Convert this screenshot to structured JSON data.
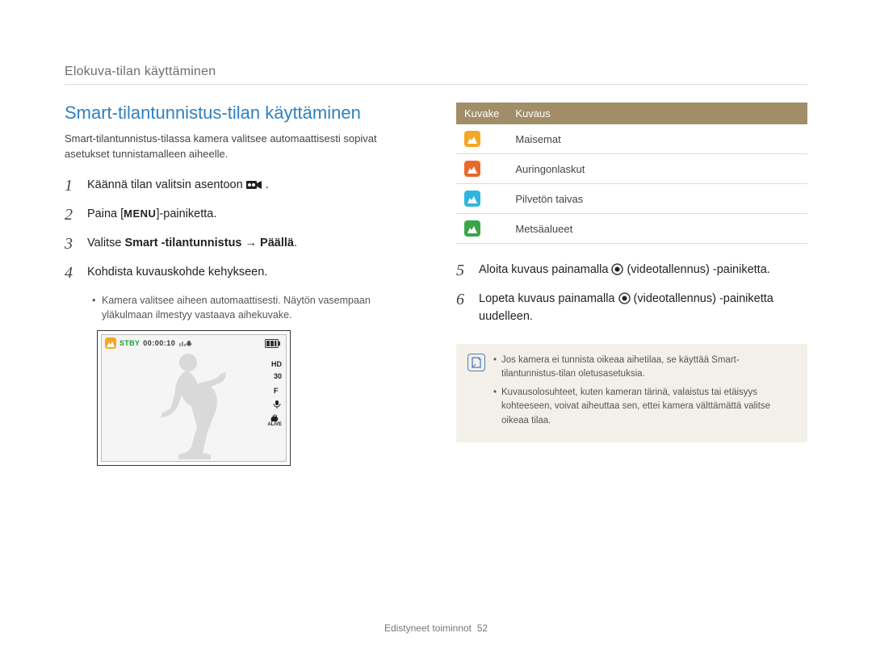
{
  "running_head": "Elokuva-tilan käyttäminen",
  "title": "Smart-tilantunnistus-tilan käyttäminen",
  "intro": "Smart-tilantunnistus-tilassa kamera valitsee automaattisesti sopivat asetukset tunnistamalleen aiheelle.",
  "steps_left": {
    "s1": {
      "num": "1",
      "pre": "Käännä tilan valitsin asentoon ",
      "post": "."
    },
    "s2": {
      "num": "2",
      "pre": "Paina [",
      "menu": "MENU",
      "post": "]-painiketta."
    },
    "s3": {
      "num": "3",
      "pre": "Valitse ",
      "bold": "Smart -tilantunnistus → Päällä",
      "post": "."
    },
    "s4": {
      "num": "4",
      "text": "Kohdista kuvauskohde kehykseen.",
      "sub": "Kamera valitsee aiheen automaattisesti. Näytön vasempaan yläkulmaan ilmestyy vastaava aihekuvake."
    }
  },
  "lcd": {
    "stby": "STBY",
    "time": "00:00:10",
    "hd": "HD",
    "fps": "30",
    "f": "F",
    "alive": "ALIVE"
  },
  "table": {
    "head_icon": "Kuvake",
    "head_desc": "Kuvaus",
    "rows": [
      {
        "color": "#f5a623",
        "label": "Maisemat"
      },
      {
        "color": "#e86a2b",
        "label": "Auringonlaskut"
      },
      {
        "color": "#2fb6e0",
        "label": "Pilvetön taivas"
      },
      {
        "color": "#3aa54a",
        "label": "Metsäalueet"
      }
    ]
  },
  "steps_right": {
    "s5": {
      "num": "5",
      "pre": "Aloita kuvaus painamalla ",
      "post": " (videotallennus) -painiketta."
    },
    "s6": {
      "num": "6",
      "pre": "Lopeta kuvaus painamalla ",
      "post": " (videotallennus) -painiketta uudelleen."
    }
  },
  "note": {
    "b1": "Jos kamera ei tunnista oikeaa aihetilaa, se käyttää Smart-tilantunnistus-tilan oletusasetuksia.",
    "b2": "Kuvausolosuhteet, kuten kameran tärinä, valaistus tai etäisyys kohteeseen, voivat aiheuttaa sen, ettei kamera välttämättä valitse oikeaa tilaa."
  },
  "footer": {
    "section": "Edistyneet toiminnot",
    "page": "52"
  }
}
